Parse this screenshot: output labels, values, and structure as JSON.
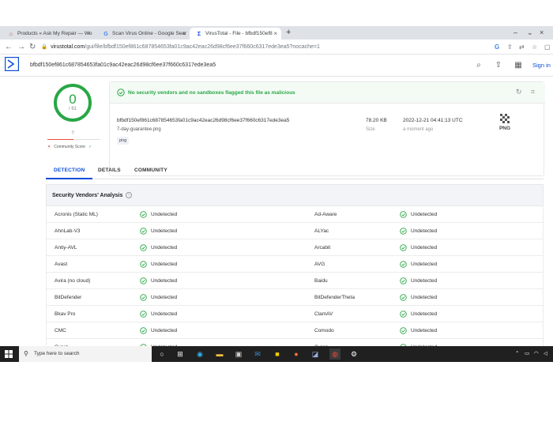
{
  "browser": {
    "tabs": [
      {
        "title": "Products « Ask My Repair — Wo",
        "favicon": "repair-icon",
        "active": false
      },
      {
        "title": "Scan Virus Online - Google Sear",
        "favicon": "google-icon",
        "active": false
      },
      {
        "title": "VirusTotal - File - bfbdf150ef8",
        "favicon": "virustotal-icon",
        "active": true
      }
    ],
    "new_tab": "+",
    "url_host": "virustotal.com",
    "url_path": "/gui/file/bfbdf150ef861c687854653fa01c9ac42eac26d98cf6ee37f660c6317ede3ea5?nocache=1"
  },
  "vt": {
    "search_value": "bfbdf150ef861c687854653fa01c9ac42eac26d98cf6ee37f660c6317ede3ea5",
    "sign_in": "Sign in",
    "score": "0",
    "score_total": "/ 61",
    "community_q": "?",
    "community_label": "Community Score",
    "banner": "No security vendors and no sandboxes flagged this file as malicious",
    "file_hash": "bfbdf150ef861c687854653fa01c9ac42eac26d98cf6ee37f660c6317ede3ea5",
    "file_name": "7-day-guarantee.png",
    "file_tag": "png",
    "file_size": "78.20 KB",
    "file_size_label": "Size",
    "file_date": "2022-12-21 04:41:13 UTC",
    "file_date_ago": "a moment ago",
    "file_type": "PNG",
    "tabs": [
      "DETECTION",
      "DETAILS",
      "COMMUNITY"
    ],
    "section_title": "Security Vendors' Analysis",
    "vendors": [
      [
        "Acronis (Static ML)",
        "Undetected",
        "Ad-Aware",
        "Undetected"
      ],
      [
        "AhnLab-V3",
        "Undetected",
        "ALYac",
        "Undetected"
      ],
      [
        "Antiy-AVL",
        "Undetected",
        "Arcabit",
        "Undetected"
      ],
      [
        "Avast",
        "Undetected",
        "AVG",
        "Undetected"
      ],
      [
        "Avira (no cloud)",
        "Undetected",
        "Baidu",
        "Undetected"
      ],
      [
        "BitDefender",
        "Undetected",
        "BitDefenderTheta",
        "Undetected"
      ],
      [
        "Bkav Pro",
        "Undetected",
        "ClamAV",
        "Undetected"
      ],
      [
        "CMC",
        "Undetected",
        "Comodo",
        "Undetected"
      ],
      [
        "Cynet",
        "Undetected",
        "Cyren",
        "Undetected"
      ]
    ],
    "colors": {
      "clean": "#28a745",
      "accent": "#0b4dda"
    }
  },
  "taskbar": {
    "search_placeholder": "Type here to search",
    "apps": [
      "task-view-icon",
      "widgets-icon",
      "edge-icon",
      "file-explorer-icon",
      "store-icon",
      "mail-icon",
      "sticky-notes-icon",
      "firefox-icon",
      "app-icon",
      "chrome-icon",
      "settings-icon"
    ]
  }
}
